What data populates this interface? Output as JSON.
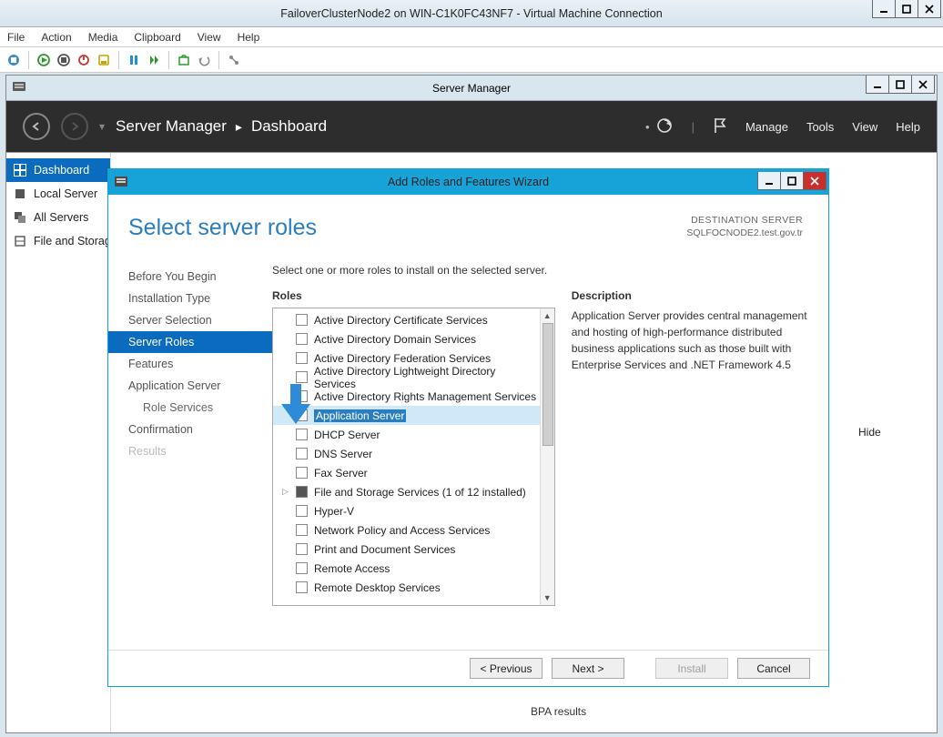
{
  "vm": {
    "title": "FailoverClusterNode2 on WIN-C1K0FC43NF7 - Virtual Machine Connection",
    "menu": {
      "file": "File",
      "action": "Action",
      "media": "Media",
      "clipboard": "Clipboard",
      "view": "View",
      "help": "Help"
    }
  },
  "sm": {
    "title": "Server Manager",
    "breadcrumb": {
      "app": "Server Manager",
      "page": "Dashboard"
    },
    "top": {
      "manage": "Manage",
      "tools": "Tools",
      "view": "View",
      "help": "Help"
    },
    "sidebar": {
      "items": [
        {
          "label": "Dashboard"
        },
        {
          "label": "Local Server"
        },
        {
          "label": "All Servers"
        },
        {
          "label": "File and Storage Services"
        }
      ]
    },
    "hide": "Hide",
    "bpa": "BPA results"
  },
  "wizard": {
    "title": "Add Roles and Features Wizard",
    "heading": "Select server roles",
    "destination": {
      "label": "DESTINATION SERVER",
      "value": "SQLFOCNODE2.test.gov.tr"
    },
    "steps": [
      {
        "label": "Before You Begin"
      },
      {
        "label": "Installation Type"
      },
      {
        "label": "Server Selection"
      },
      {
        "label": "Server Roles",
        "active": true
      },
      {
        "label": "Features"
      },
      {
        "label": "Application Server"
      },
      {
        "label": "Role Services",
        "sub": true
      },
      {
        "label": "Confirmation"
      },
      {
        "label": "Results",
        "disabled": true
      }
    ],
    "subtext": "Select one or more roles to install on the selected server.",
    "roles_label": "Roles",
    "description_label": "Description",
    "roles": [
      {
        "label": "Active Directory Certificate Services"
      },
      {
        "label": "Active Directory Domain Services"
      },
      {
        "label": "Active Directory Federation Services"
      },
      {
        "label": "Active Directory Lightweight Directory Services"
      },
      {
        "label": "Active Directory Rights Management Services"
      },
      {
        "label": "Application Server",
        "checked": true,
        "selected": true
      },
      {
        "label": "DHCP Server"
      },
      {
        "label": "DNS Server"
      },
      {
        "label": "Fax Server"
      },
      {
        "label": "File and Storage Services (1 of 12 installed)",
        "expandable": true,
        "filled": true
      },
      {
        "label": "Hyper-V"
      },
      {
        "label": "Network Policy and Access Services"
      },
      {
        "label": "Print and Document Services"
      },
      {
        "label": "Remote Access"
      },
      {
        "label": "Remote Desktop Services"
      }
    ],
    "description": "Application Server provides central management and hosting of high-performance distributed business applications such as those built with Enterprise Services and .NET Framework 4.5",
    "buttons": {
      "previous": "< Previous",
      "next": "Next >",
      "install": "Install",
      "cancel": "Cancel"
    }
  }
}
